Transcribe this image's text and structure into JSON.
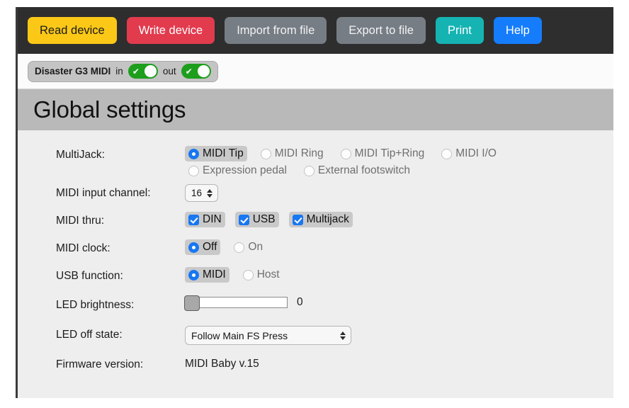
{
  "toolbar": {
    "buttons": [
      {
        "label": "Read device",
        "name": "read-device-button",
        "style": "tbtn-read"
      },
      {
        "label": "Write device",
        "name": "write-device-button",
        "style": "tbtn-write"
      },
      {
        "label": "Import from file",
        "name": "import-from-file-button",
        "style": "tbtn-gray"
      },
      {
        "label": "Export to file",
        "name": "export-to-file-button",
        "style": "tbtn-gray"
      },
      {
        "label": "Print",
        "name": "print-button",
        "style": "tbtn-print"
      },
      {
        "label": "Help",
        "name": "help-button",
        "style": "tbtn-help"
      }
    ],
    "colors": {
      "read": "#fbc817",
      "write": "#e23b4e",
      "gray": "#767d85",
      "print": "#16b3b3",
      "help": "#157dfb",
      "background": "#2e2e2e"
    }
  },
  "device_bar": {
    "device_name": "Disaster G3 MIDI",
    "in_label": "in",
    "out_label": "out",
    "in_enabled": "on",
    "out_enabled": "on",
    "toggle_color": "#1d9e1d",
    "check_glyph": "✔"
  },
  "section": {
    "title": "Global settings"
  },
  "settings": {
    "multijack": {
      "label": "MultiJack:",
      "options_row1": [
        {
          "label": "MIDI Tip",
          "selected": true
        },
        {
          "label": "MIDI Ring",
          "selected": false
        },
        {
          "label": "MIDI Tip+Ring",
          "selected": false
        },
        {
          "label": "MIDI I/O",
          "selected": false
        }
      ],
      "options_row2": [
        {
          "label": "Expression pedal",
          "selected": false
        },
        {
          "label": "External footswitch",
          "selected": false
        }
      ]
    },
    "midi_input_channel": {
      "label": "MIDI input channel:",
      "value": "16"
    },
    "midi_thru": {
      "label": "MIDI thru:",
      "options": [
        {
          "label": "DIN",
          "checked": true
        },
        {
          "label": "USB",
          "checked": true
        },
        {
          "label": "Multijack",
          "checked": true
        }
      ]
    },
    "midi_clock": {
      "label": "MIDI clock:",
      "options": [
        {
          "label": "Off",
          "selected": true
        },
        {
          "label": "On",
          "selected": false
        }
      ]
    },
    "usb_function": {
      "label": "USB function:",
      "options": [
        {
          "label": "MIDI",
          "selected": true
        },
        {
          "label": "Host",
          "selected": false
        }
      ]
    },
    "led_brightness": {
      "label": "LED brightness:",
      "value": "0",
      "percent": 0
    },
    "led_off_state": {
      "label": "LED off state:",
      "value": "Follow Main FS Press"
    },
    "firmware_version": {
      "label": "Firmware version:",
      "value": "MIDI Baby v.15"
    }
  }
}
